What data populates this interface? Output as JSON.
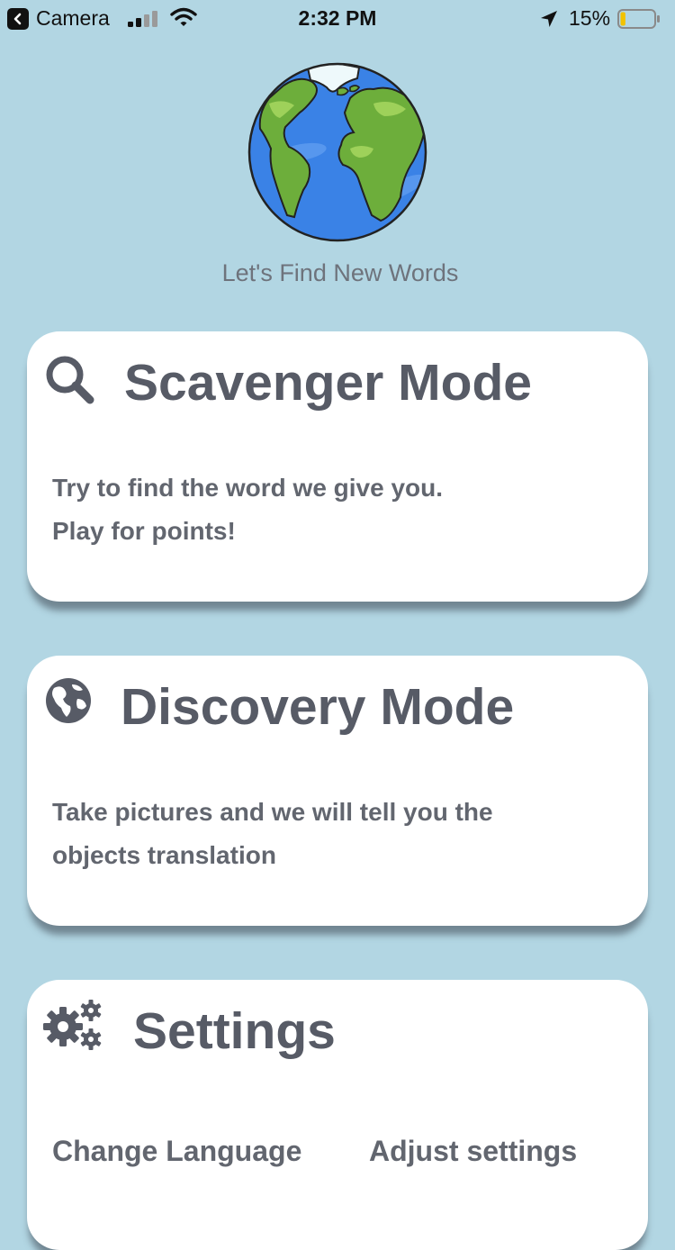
{
  "status_bar": {
    "back_app": "Camera",
    "time": "2:32 PM",
    "battery": "15%",
    "battery_level": 0.15
  },
  "header": {
    "tagline": "Let's Find New Words",
    "logo_icon": "globe-icon"
  },
  "cards": {
    "scavenger": {
      "title": "Scavenger Mode",
      "icon": "search-icon",
      "line1": "Try to find the word we give you.",
      "line2": "Play for points!"
    },
    "discovery": {
      "title": "Discovery Mode",
      "icon": "globe-icon",
      "line1": "Take pictures and we will tell you the",
      "line2": "objects translation"
    },
    "settings": {
      "title": "Settings",
      "icon": "gears-icon",
      "change_language": "Change Language",
      "adjust_settings": "Adjust settings"
    }
  },
  "colors": {
    "background": "#b2d6e3",
    "card": "#ffffff",
    "text": "#575b66"
  }
}
